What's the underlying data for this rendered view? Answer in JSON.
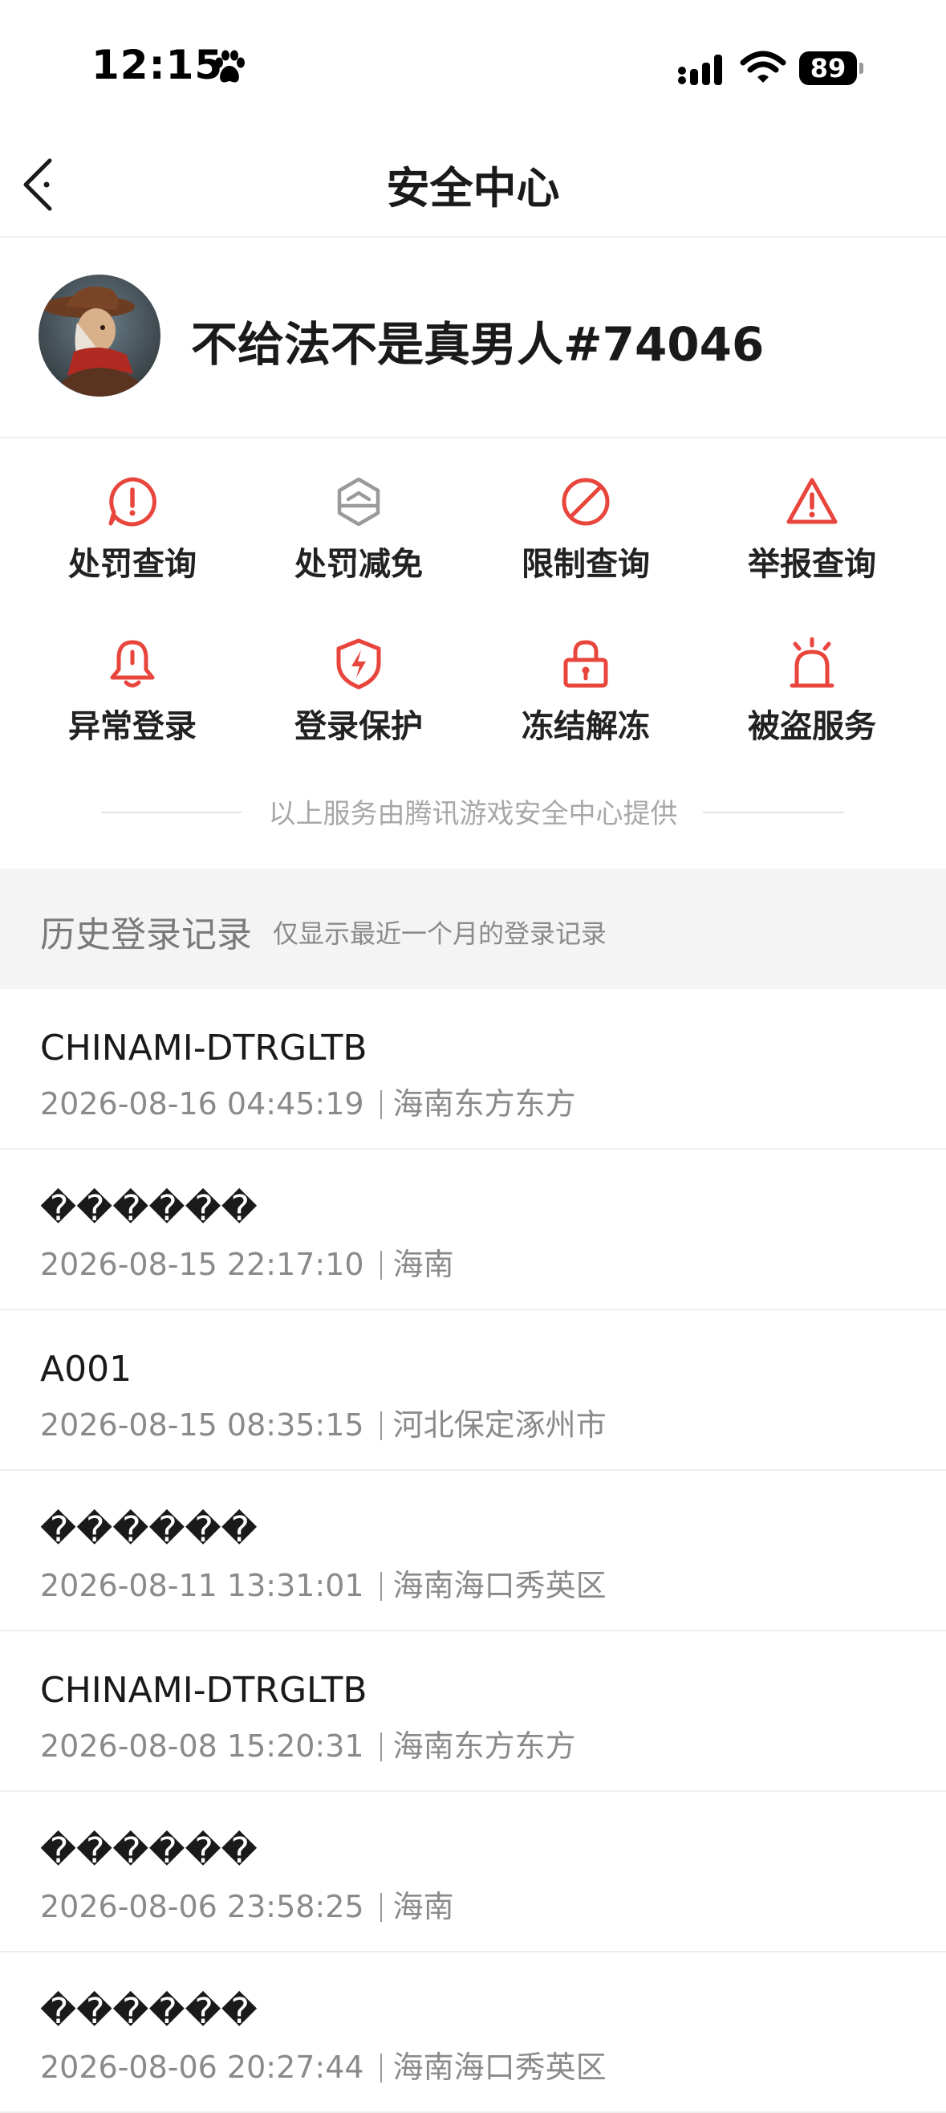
{
  "status_bar": {
    "time": "12:15",
    "battery": "89"
  },
  "nav": {
    "title": "安全中心"
  },
  "profile": {
    "username": "不给法不是真男人#74046"
  },
  "services": {
    "items": [
      {
        "label": "处罚查询",
        "icon": "alert-bubble-icon"
      },
      {
        "label": "处罚减免",
        "icon": "reduce-hexagon-icon"
      },
      {
        "label": "限制查询",
        "icon": "prohibited-icon"
      },
      {
        "label": "举报查询",
        "icon": "warning-triangle-icon"
      },
      {
        "label": "异常登录",
        "icon": "bell-icon"
      },
      {
        "label": "登录保护",
        "icon": "shield-bolt-icon"
      },
      {
        "label": "冻结解冻",
        "icon": "lock-icon"
      },
      {
        "label": "被盗服务",
        "icon": "alarm-siren-icon"
      }
    ],
    "provider": "以上服务由腾讯游戏安全中心提供"
  },
  "colors": {
    "accent": "#e8453c",
    "muted_icon": "#9a9a9a"
  },
  "history": {
    "title": "历史登录记录",
    "subtitle": "仅显示最近一个月的登录记录",
    "records": [
      {
        "device": "CHINAMI-DTRGLTB",
        "time": "2026-08-16 04:45:19",
        "location": "海南东方东方"
      },
      {
        "device": "������",
        "time": "2026-08-15 22:17:10",
        "location": "海南"
      },
      {
        "device": "A001",
        "time": "2026-08-15 08:35:15",
        "location": "河北保定涿州市"
      },
      {
        "device": "������",
        "time": "2026-08-11 13:31:01",
        "location": "海南海口秀英区"
      },
      {
        "device": "CHINAMI-DTRGLTB",
        "time": "2026-08-08 15:20:31",
        "location": "海南东方东方"
      },
      {
        "device": "������",
        "time": "2026-08-06 23:58:25",
        "location": "海南"
      },
      {
        "device": "������",
        "time": "2026-08-06 20:27:44",
        "location": "海南海口秀英区"
      }
    ]
  }
}
